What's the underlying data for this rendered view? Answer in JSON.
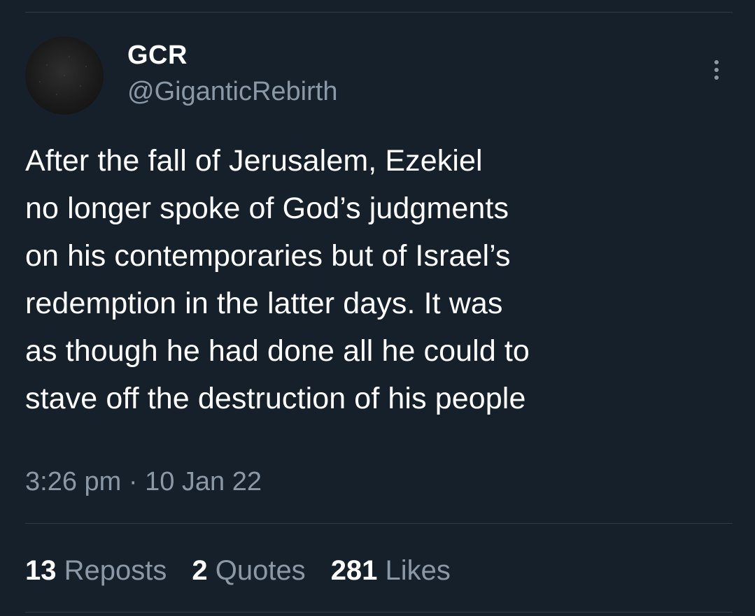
{
  "author": {
    "display_name": "GCR",
    "handle": "@GiganticRebirth",
    "avatar_icon": "avatar-image"
  },
  "menu": {
    "icon": "more-vertical-icon"
  },
  "tweet": {
    "text": "After the fall of Jerusalem, Ezekiel\nno longer spoke of God’s judgments\non his contemporaries but of Israel’s\nredemption in the latter days. It was\nas though he had done all he could to\nstave off the destruction of his people",
    "timestamp": "3:26 pm · 10 Jan 22"
  },
  "stats": {
    "reposts": {
      "count": "13",
      "label": "Reposts"
    },
    "quotes": {
      "count": "2",
      "label": "Quotes"
    },
    "likes": {
      "count": "281",
      "label": "Likes"
    }
  },
  "colors": {
    "background": "#15202b",
    "primary_text": "#ffffff",
    "secondary_text": "#8b98a5",
    "divider": "#2f3b47"
  }
}
